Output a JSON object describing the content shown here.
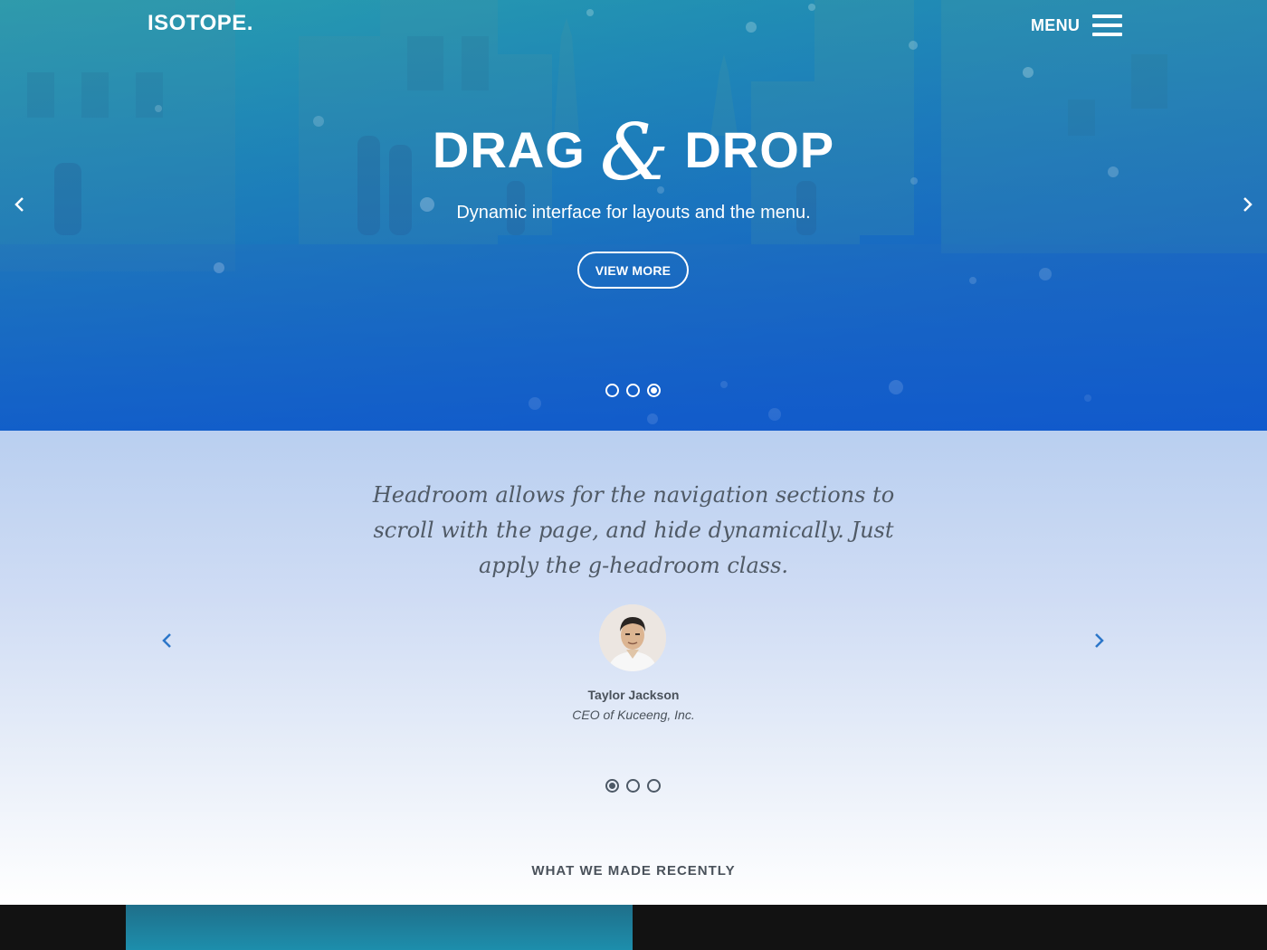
{
  "header": {
    "logo": "ISOTOPE.",
    "menu_label": "MENU"
  },
  "hero": {
    "title_left": "DRAG",
    "title_amp": "&",
    "title_right": "DROP",
    "subtitle": "Dynamic interface for layouts and the menu.",
    "button_label": "VIEW MORE",
    "slides": 3,
    "active_slide": 3
  },
  "testimonial": {
    "quote": "Headroom allows for the navigation sections to scroll with the page, and hide dynamically. Just apply the g-headroom class.",
    "author_name": "Taylor Jackson",
    "author_role": "CEO of Kuceeng, Inc.",
    "slides": 3,
    "active_slide": 1
  },
  "recent": {
    "heading": "WHAT WE MADE RECENTLY"
  },
  "colors": {
    "hero_top": "#2a9fb0",
    "hero_bottom": "#0f56cf",
    "arrow_blue": "#2b76c9",
    "text_dark": "#4a525b",
    "gallery_bg": "#121212"
  }
}
